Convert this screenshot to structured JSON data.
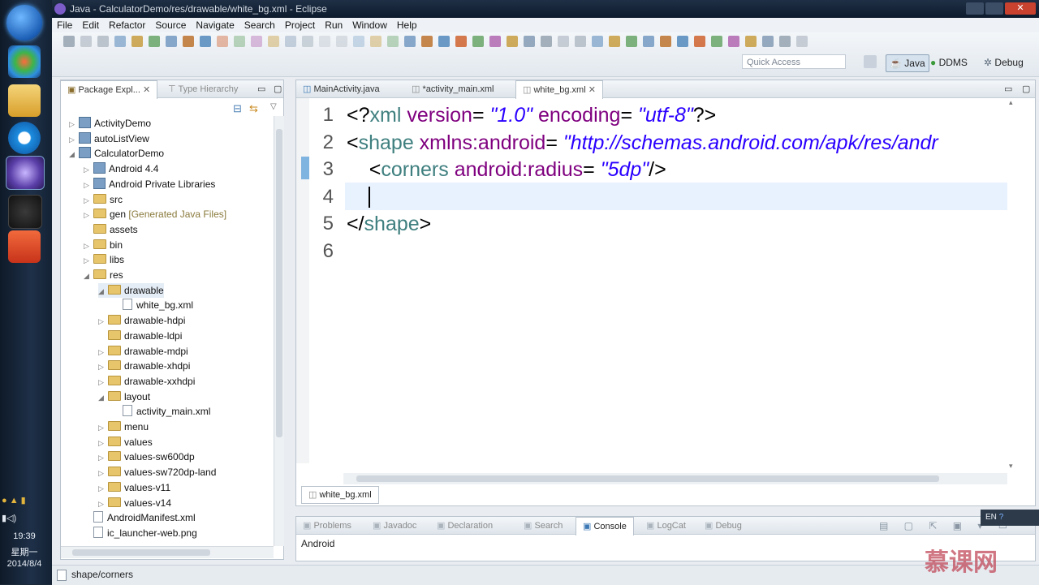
{
  "window": {
    "title": "Java - CalculatorDemo/res/drawable/white_bg.xml - Eclipse"
  },
  "menu": [
    "File",
    "Edit",
    "Refactor",
    "Source",
    "Navigate",
    "Search",
    "Project",
    "Run",
    "Window",
    "Help"
  ],
  "toolbar": {
    "quick_access": "Quick Access",
    "perspectives": [
      "Java",
      "DDMS",
      "Debug"
    ]
  },
  "left_panel": {
    "tabs": [
      "Package Expl...",
      "Type Hierarchy"
    ],
    "tree": [
      {
        "label": "ActivityDemo",
        "kind": "project",
        "arrow": "▷"
      },
      {
        "label": "autoListView",
        "kind": "project",
        "arrow": "▷"
      },
      {
        "label": "CalculatorDemo",
        "kind": "project",
        "arrow": "◢"
      },
      {
        "label": "Android 4.4",
        "kind": "lib",
        "arrow": "▷"
      },
      {
        "label": "Android Private Libraries",
        "kind": "lib",
        "arrow": "▷"
      },
      {
        "label": "src",
        "kind": "folder",
        "arrow": "▷"
      },
      {
        "label": "gen",
        "extra": "[Generated Java Files]",
        "kind": "folder",
        "arrow": "▷"
      },
      {
        "label": "assets",
        "kind": "folder",
        "arrow": ""
      },
      {
        "label": "bin",
        "kind": "folder",
        "arrow": "▷"
      },
      {
        "label": "libs",
        "kind": "folder",
        "arrow": "▷"
      },
      {
        "label": "res",
        "kind": "folder",
        "arrow": "◢"
      },
      {
        "label": "drawable",
        "kind": "folder",
        "arrow": "◢"
      },
      {
        "label": "white_bg.xml",
        "kind": "file",
        "arrow": ""
      },
      {
        "label": "drawable-hdpi",
        "kind": "folder",
        "arrow": "▷"
      },
      {
        "label": "drawable-ldpi",
        "kind": "folder",
        "arrow": ""
      },
      {
        "label": "drawable-mdpi",
        "kind": "folder",
        "arrow": "▷"
      },
      {
        "label": "drawable-xhdpi",
        "kind": "folder",
        "arrow": "▷"
      },
      {
        "label": "drawable-xxhdpi",
        "kind": "folder",
        "arrow": "▷"
      },
      {
        "label": "layout",
        "kind": "folder",
        "arrow": "◢"
      },
      {
        "label": "activity_main.xml",
        "kind": "file",
        "arrow": ""
      },
      {
        "label": "menu",
        "kind": "folder",
        "arrow": "▷"
      },
      {
        "label": "values",
        "kind": "folder",
        "arrow": "▷"
      },
      {
        "label": "values-sw600dp",
        "kind": "folder",
        "arrow": "▷"
      },
      {
        "label": "values-sw720dp-land",
        "kind": "folder",
        "arrow": "▷"
      },
      {
        "label": "values-v11",
        "kind": "folder",
        "arrow": "▷"
      },
      {
        "label": "values-v14",
        "kind": "folder",
        "arrow": "▷"
      },
      {
        "label": "AndroidManifest.xml",
        "kind": "file",
        "arrow": ""
      },
      {
        "label": "ic_launcher-web.png",
        "kind": "file",
        "arrow": ""
      }
    ]
  },
  "editor": {
    "tabs": [
      "MainActivity.java",
      "*activity_main.xml",
      "white_bg.xml"
    ],
    "bottom_tab": "white_bg.xml",
    "line_numbers": [
      "1",
      "2",
      "3",
      "4",
      "5",
      "6"
    ],
    "lines": [
      [
        [
          "p",
          "<?"
        ],
        [
          "k",
          "xml"
        ],
        [
          "a",
          " version"
        ],
        [
          "p",
          "= "
        ],
        [
          "s",
          "\"1.0\""
        ],
        [
          "a",
          " encoding"
        ],
        [
          "p",
          "= "
        ],
        [
          "s",
          "\"utf-8\""
        ],
        [
          "p",
          "?>"
        ]
      ],
      [
        [
          "p",
          "<"
        ],
        [
          "k",
          "shape"
        ],
        [
          "a",
          " xmlns:android"
        ],
        [
          "p",
          "= "
        ],
        [
          "s",
          "\"http://schemas.android.com/apk/res/andr"
        ]
      ],
      [
        [
          "p",
          "    <"
        ],
        [
          "k",
          "corners"
        ],
        [
          "a",
          " android:radius"
        ],
        [
          "p",
          "= "
        ],
        [
          "s",
          "\"5dp\""
        ],
        [
          "p",
          "/>"
        ]
      ],
      [],
      [
        [
          "p",
          "</"
        ],
        [
          "k",
          "shape"
        ],
        [
          "p",
          ">"
        ]
      ],
      []
    ]
  },
  "console": {
    "tabs": [
      "Problems",
      "Javadoc",
      "Declaration",
      "Search",
      "Console",
      "LogCat",
      "Debug"
    ],
    "content": "Android"
  },
  "status_bar": {
    "text": "shape/corners"
  },
  "system_tray": {
    "time": "19:39",
    "day": "星期一",
    "date": "2014/8/4",
    "ime": "EN"
  },
  "watermark": "慕课网"
}
